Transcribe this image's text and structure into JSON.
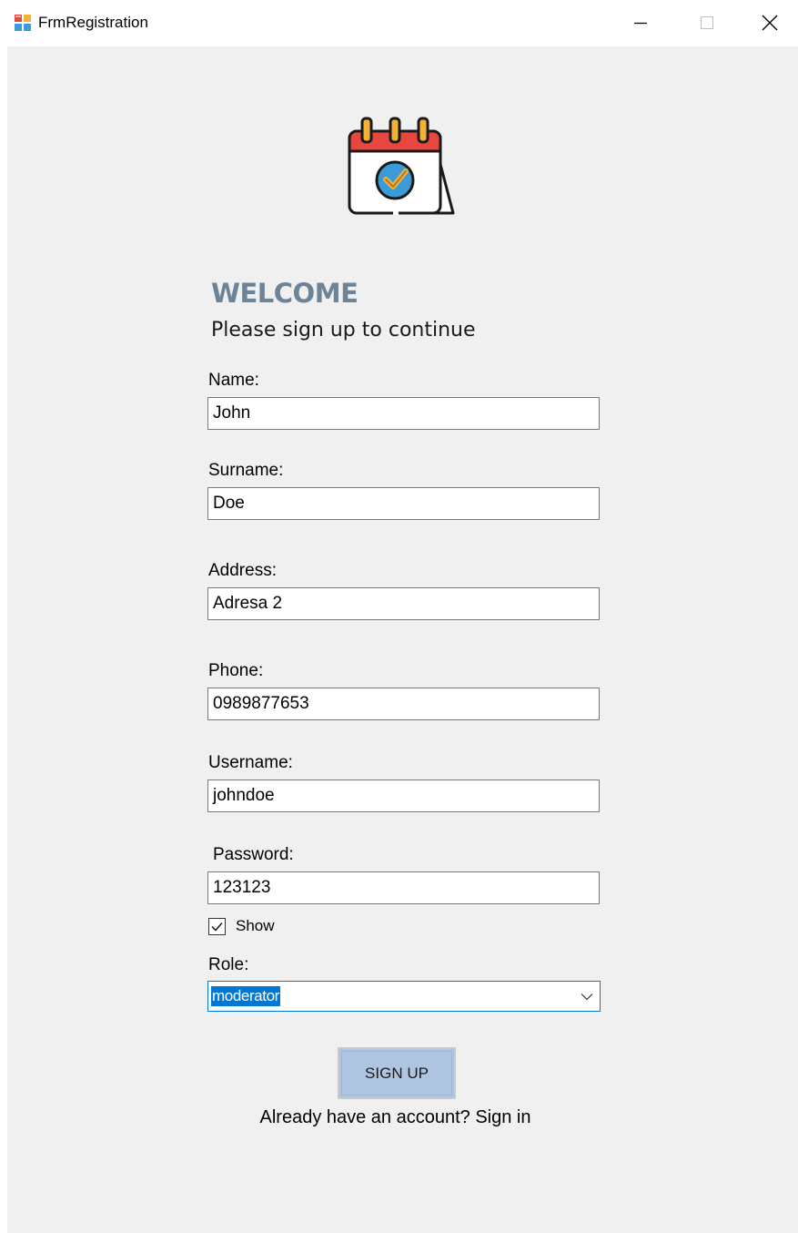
{
  "window": {
    "title": "FrmRegistration"
  },
  "form": {
    "welcome": "WELCOME",
    "subtitle": "Please sign up to continue",
    "fields": [
      {
        "label": "Name:",
        "value": "John"
      },
      {
        "label": "Surname:",
        "value": "Doe"
      },
      {
        "label": "Address:",
        "value": "Adresa 2"
      },
      {
        "label": "Phone:",
        "value": "0989877653"
      },
      {
        "label": "Username:",
        "value": "johndoe"
      },
      {
        "label": "Password:",
        "value": "123123"
      }
    ],
    "show_password": {
      "label": "Show",
      "checked": true
    },
    "role": {
      "label": "Role:",
      "selected": "moderator"
    },
    "signup_button": "SIGN UP",
    "signin_link": "Already have an account? Sign in"
  },
  "icons": {
    "app": "app-window-icon",
    "logo": "calendar-check-icon",
    "minimize": "minimize-icon",
    "maximize": "maximize-icon",
    "close": "close-icon",
    "dropdown": "chevron-down-icon",
    "checkmark": "checkmark-icon"
  },
  "colors": {
    "welcome": "#6d8397",
    "client_background": "#f0f0f0",
    "button": "#aec4e0",
    "selection": "#0078d7",
    "calendar_red": "#e8473f",
    "calendar_yellow": "#f6b132",
    "calendar_blue": "#3b9bd9"
  }
}
